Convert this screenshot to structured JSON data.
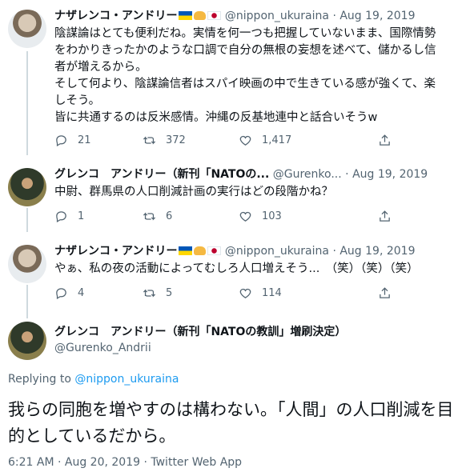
{
  "tweets": [
    {
      "name": "ナザレンコ・アンドリー",
      "handle": "@nippon_ukuraina",
      "date": "Aug 19, 2019",
      "lines": [
        "陰謀論はとても便利だね。実情を何一つも把握していないまま、国際情勢",
        "をわかりきったかのような口調で自分の無根の妄想を述べて、儲かるし信",
        "者が増えるから。",
        "そして何より、陰謀論信者はスパイ映画の中で生きている感が強くて、楽",
        "しそう。",
        "皆に共通するのは反米感情。沖縄の反基地連中と話合いそうw"
      ],
      "replies": "21",
      "retweets": "372",
      "likes": "1,417"
    },
    {
      "name": "グレンコ　アンドリー（新刊「NATOの...",
      "handle": "@Gurenko...",
      "date": "Aug 19, 2019",
      "lines": [
        "中尉、群馬県の人口削減計画の実行はどの段階かね？"
      ],
      "replies": "1",
      "retweets": "6",
      "likes": "103"
    },
    {
      "name": "ナザレンコ・アンドリー",
      "handle": "@nippon_ukuraina",
      "date": "Aug 19, 2019",
      "lines": [
        "やぁ、私の夜の活動によってむしろ人口増えそう...　（笑）（笑）（笑）"
      ],
      "replies": "4",
      "retweets": "5",
      "likes": "114"
    }
  ],
  "main": {
    "name": "グレンコ　アンドリー（新刊「NATOの教訓」増刷決定）",
    "handle": "@Gurenko_Andrii",
    "replying_prefix": "Replying to",
    "replying_to": "@nippon_ukuraina",
    "text": "我らの同胞を増やすのは構わない。「人間」の人口削減を目的としているだから。",
    "meta": "6:21 AM · Aug 20, 2019 · Twitter Web App"
  },
  "icons": [
    "reply-icon",
    "retweet-icon",
    "like-icon",
    "share-icon"
  ]
}
